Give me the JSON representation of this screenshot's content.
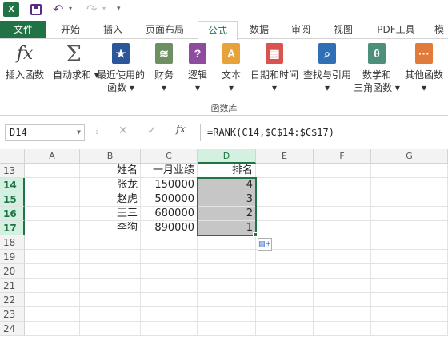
{
  "qat": {
    "app_logo": "X",
    "save_icon": "save-icon",
    "undo_icon": "undo-icon",
    "redo_icon": "redo-icon"
  },
  "tabs": [
    {
      "label": "文件"
    },
    {
      "label": "开始"
    },
    {
      "label": "插入"
    },
    {
      "label": "页面布局"
    },
    {
      "label": "公式"
    },
    {
      "label": "数据"
    },
    {
      "label": "审阅"
    },
    {
      "label": "视图"
    },
    {
      "label": "PDF工具"
    },
    {
      "label": "模"
    }
  ],
  "ribbon": {
    "buttons": [
      {
        "label": "插入函数",
        "label2": ""
      },
      {
        "label": "自动求和 ▾",
        "label2": ""
      },
      {
        "label": "最近使用的",
        "label2": "函数 ▾"
      },
      {
        "label": "财务",
        "label2": "▾"
      },
      {
        "label": "逻辑",
        "label2": "▾"
      },
      {
        "label": "文本",
        "label2": "▾"
      },
      {
        "label": "日期和时间",
        "label2": "▾"
      },
      {
        "label": "查找与引用",
        "label2": "▾"
      },
      {
        "label": "数学和",
        "label2": "三角函数 ▾"
      },
      {
        "label": "其他函数",
        "label2": "▾"
      }
    ],
    "group_label": "函数库"
  },
  "formula_bar": {
    "name_box": "D14",
    "formula": "=RANK(C14,$C$14:$C$17)",
    "fx_label": "fx"
  },
  "grid": {
    "columns": [
      "A",
      "B",
      "C",
      "D",
      "E",
      "F",
      "G"
    ],
    "selected_column": "D",
    "rows": [
      {
        "num": "13",
        "B": "姓名",
        "C": "一月业绩",
        "D": "排名"
      },
      {
        "num": "14",
        "B": "张龙",
        "C": "150000",
        "D": "4"
      },
      {
        "num": "15",
        "B": "赵虎",
        "C": "500000",
        "D": "3"
      },
      {
        "num": "16",
        "B": "王三",
        "C": "680000",
        "D": "2"
      },
      {
        "num": "17",
        "B": "李狗",
        "C": "890000",
        "D": "1"
      },
      {
        "num": "18"
      },
      {
        "num": "19"
      },
      {
        "num": "20"
      },
      {
        "num": "21"
      },
      {
        "num": "22"
      },
      {
        "num": "23"
      },
      {
        "num": "24"
      }
    ]
  }
}
